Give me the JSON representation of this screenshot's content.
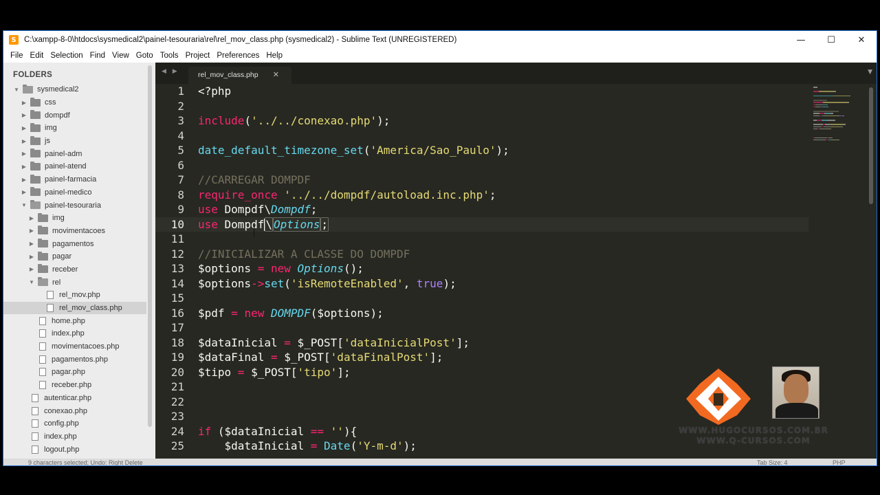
{
  "window": {
    "title": "C:\\xampp-8-0\\htdocs\\sysmedical2\\painel-tesouraria\\rel\\rel_mov_class.php (sysmedical2) - Sublime Text (UNREGISTERED)",
    "app_icon": "S",
    "minimize": "—",
    "maximize": "☐",
    "close": "✕"
  },
  "menu": [
    "File",
    "Edit",
    "Selection",
    "Find",
    "View",
    "Goto",
    "Tools",
    "Project",
    "Preferences",
    "Help"
  ],
  "sidebar": {
    "heading": "FOLDERS",
    "tree": [
      {
        "label": "sysmedical2",
        "type": "folder",
        "open": true,
        "depth": 0
      },
      {
        "label": "css",
        "type": "folder",
        "open": false,
        "depth": 1
      },
      {
        "label": "dompdf",
        "type": "folder",
        "open": false,
        "depth": 1
      },
      {
        "label": "img",
        "type": "folder",
        "open": false,
        "depth": 1
      },
      {
        "label": "js",
        "type": "folder",
        "open": false,
        "depth": 1
      },
      {
        "label": "painel-adm",
        "type": "folder",
        "open": false,
        "depth": 1
      },
      {
        "label": "painel-atend",
        "type": "folder",
        "open": false,
        "depth": 1
      },
      {
        "label": "painel-farmacia",
        "type": "folder",
        "open": false,
        "depth": 1
      },
      {
        "label": "painel-medico",
        "type": "folder",
        "open": false,
        "depth": 1
      },
      {
        "label": "painel-tesouraria",
        "type": "folder",
        "open": true,
        "depth": 1
      },
      {
        "label": "img",
        "type": "folder",
        "open": false,
        "depth": 2
      },
      {
        "label": "movimentacoes",
        "type": "folder",
        "open": false,
        "depth": 2
      },
      {
        "label": "pagamentos",
        "type": "folder",
        "open": false,
        "depth": 2
      },
      {
        "label": "pagar",
        "type": "folder",
        "open": false,
        "depth": 2
      },
      {
        "label": "receber",
        "type": "folder",
        "open": false,
        "depth": 2
      },
      {
        "label": "rel",
        "type": "folder",
        "open": true,
        "depth": 2
      },
      {
        "label": "rel_mov.php",
        "type": "file",
        "depth": 3
      },
      {
        "label": "rel_mov_class.php",
        "type": "file",
        "depth": 3,
        "selected": true
      },
      {
        "label": "home.php",
        "type": "file",
        "depth": 2
      },
      {
        "label": "index.php",
        "type": "file",
        "depth": 2
      },
      {
        "label": "movimentacoes.php",
        "type": "file",
        "depth": 2
      },
      {
        "label": "pagamentos.php",
        "type": "file",
        "depth": 2
      },
      {
        "label": "pagar.php",
        "type": "file",
        "depth": 2
      },
      {
        "label": "receber.php",
        "type": "file",
        "depth": 2
      },
      {
        "label": "autenticar.php",
        "type": "file",
        "depth": 1
      },
      {
        "label": "conexao.php",
        "type": "file",
        "depth": 1
      },
      {
        "label": "config.php",
        "type": "file",
        "depth": 1
      },
      {
        "label": "index.php",
        "type": "file",
        "depth": 1
      },
      {
        "label": "logout.php",
        "type": "file",
        "depth": 1
      }
    ]
  },
  "tabbar": {
    "nav": "◀ ▶",
    "active_tab": "rel_mov_class.php",
    "close_icon": "✕",
    "menu_icon": "▼"
  },
  "editor": {
    "current_line": 10,
    "lines": [
      {
        "n": "1",
        "tokens": [
          {
            "t": "<?php",
            "c": ""
          }
        ]
      },
      {
        "n": "2",
        "tokens": []
      },
      {
        "n": "3",
        "tokens": [
          {
            "t": "include",
            "c": "kw"
          },
          {
            "t": "(",
            "c": ""
          },
          {
            "t": "'../../conexao.php'",
            "c": "str"
          },
          {
            "t": ");",
            "c": ""
          }
        ]
      },
      {
        "n": "4",
        "tokens": []
      },
      {
        "n": "5",
        "tokens": [
          {
            "t": "date_default_timezone_set",
            "c": "fn"
          },
          {
            "t": "(",
            "c": ""
          },
          {
            "t": "'America/Sao_Paulo'",
            "c": "str"
          },
          {
            "t": ");",
            "c": ""
          }
        ]
      },
      {
        "n": "6",
        "tokens": []
      },
      {
        "n": "7",
        "tokens": [
          {
            "t": "//CARREGAR DOMPDF",
            "c": "cmt"
          }
        ]
      },
      {
        "n": "8",
        "tokens": [
          {
            "t": "require_once",
            "c": "kw"
          },
          {
            "t": " ",
            "c": ""
          },
          {
            "t": "'../../dompdf/autoload.inc.php'",
            "c": "str"
          },
          {
            "t": ";",
            "c": ""
          }
        ]
      },
      {
        "n": "9",
        "tokens": [
          {
            "t": "use",
            "c": "kw"
          },
          {
            "t": " Dompdf\\",
            "c": ""
          },
          {
            "t": "Dompdf",
            "c": "cls"
          },
          {
            "t": ";",
            "c": ""
          }
        ]
      },
      {
        "n": "10",
        "tokens": [
          {
            "t": "use",
            "c": "kw"
          },
          {
            "t": " Dompdf",
            "c": ""
          },
          {
            "t": "",
            "c": "caret"
          },
          {
            "t": "\\",
            "c": "sel"
          },
          {
            "t": "Options",
            "c": "cls sel"
          },
          {
            "t": ";",
            "c": "sel"
          }
        ]
      },
      {
        "n": "11",
        "tokens": []
      },
      {
        "n": "12",
        "tokens": [
          {
            "t": "//INICIALIZAR A CLASSE DO DOMPDF",
            "c": "cmt"
          }
        ]
      },
      {
        "n": "13",
        "tokens": [
          {
            "t": "$options",
            "c": ""
          },
          {
            "t": " = ",
            "c": "kw"
          },
          {
            "t": "new",
            "c": "kw"
          },
          {
            "t": " ",
            "c": ""
          },
          {
            "t": "Options",
            "c": "cls"
          },
          {
            "t": "();",
            "c": ""
          }
        ]
      },
      {
        "n": "14",
        "tokens": [
          {
            "t": "$options",
            "c": ""
          },
          {
            "t": "->",
            "c": "kw"
          },
          {
            "t": "set",
            "c": "fn"
          },
          {
            "t": "(",
            "c": ""
          },
          {
            "t": "'isRemoteEnabled'",
            "c": "str"
          },
          {
            "t": ", ",
            "c": ""
          },
          {
            "t": "true",
            "c": "const"
          },
          {
            "t": ");",
            "c": ""
          }
        ]
      },
      {
        "n": "15",
        "tokens": []
      },
      {
        "n": "16",
        "tokens": [
          {
            "t": "$pdf",
            "c": ""
          },
          {
            "t": " = ",
            "c": "kw"
          },
          {
            "t": "new",
            "c": "kw"
          },
          {
            "t": " ",
            "c": ""
          },
          {
            "t": "DOMPDF",
            "c": "cls"
          },
          {
            "t": "($options);",
            "c": ""
          }
        ]
      },
      {
        "n": "17",
        "tokens": []
      },
      {
        "n": "18",
        "tokens": [
          {
            "t": "$dataInicial",
            "c": ""
          },
          {
            "t": " = ",
            "c": "kw"
          },
          {
            "t": "$_POST[",
            "c": ""
          },
          {
            "t": "'dataInicialPost'",
            "c": "str"
          },
          {
            "t": "];",
            "c": ""
          }
        ]
      },
      {
        "n": "19",
        "tokens": [
          {
            "t": "$dataFinal",
            "c": ""
          },
          {
            "t": " = ",
            "c": "kw"
          },
          {
            "t": "$_POST[",
            "c": ""
          },
          {
            "t": "'dataFinalPost'",
            "c": "str"
          },
          {
            "t": "];",
            "c": ""
          }
        ]
      },
      {
        "n": "20",
        "tokens": [
          {
            "t": "$tipo",
            "c": ""
          },
          {
            "t": " = ",
            "c": "kw"
          },
          {
            "t": "$_POST[",
            "c": ""
          },
          {
            "t": "'tipo'",
            "c": "str"
          },
          {
            "t": "];",
            "c": ""
          }
        ]
      },
      {
        "n": "21",
        "tokens": []
      },
      {
        "n": "22",
        "tokens": []
      },
      {
        "n": "23",
        "tokens": []
      },
      {
        "n": "24",
        "tokens": [
          {
            "t": "if",
            "c": "kw"
          },
          {
            "t": " ($dataInicial ",
            "c": ""
          },
          {
            "t": "==",
            "c": "kw"
          },
          {
            "t": " ",
            "c": ""
          },
          {
            "t": "''",
            "c": "str"
          },
          {
            "t": "){",
            "c": ""
          }
        ]
      },
      {
        "n": "25",
        "tokens": [
          {
            "t": "    $dataInicial",
            "c": ""
          },
          {
            "t": " = ",
            "c": "kw"
          },
          {
            "t": "Date",
            "c": "fn"
          },
          {
            "t": "(",
            "c": ""
          },
          {
            "t": "'Y-m-d'",
            "c": "str"
          },
          {
            "t": ");",
            "c": ""
          }
        ]
      }
    ]
  },
  "statusbar": {
    "left": "9 characters selected; Undo: Right Delete",
    "tab_size": "Tab Size: 4",
    "syntax": "PHP"
  },
  "watermark": {
    "line1": "WWW.HUGOCURSOS.COM.BR",
    "line2": "WWW.Q-CURSOS.COM"
  },
  "colors": {
    "editor_bg": "#272822",
    "keyword": "#f92672",
    "function": "#66d9ef",
    "string": "#e6db74",
    "comment": "#75715e",
    "constant": "#ae81ff",
    "logo_orange": "#f26a21"
  }
}
